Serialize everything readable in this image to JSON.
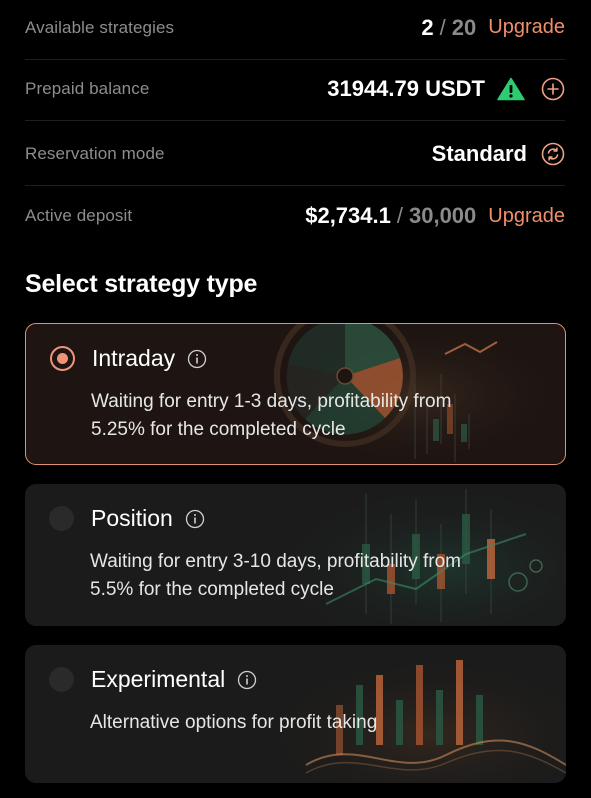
{
  "settings": {
    "strategies": {
      "label": "Available strategies",
      "used": "2",
      "separator": "/",
      "total": "20",
      "action": "Upgrade"
    },
    "balance": {
      "label": "Prepaid balance",
      "value": "31944.79 USDT",
      "status_icon": "warning-triangle-icon",
      "status_color": "#2ecc71",
      "action_icon": "plus-circle-icon"
    },
    "reservation": {
      "label": "Reservation mode",
      "value": "Standard",
      "action_icon": "swap-cycle-icon"
    },
    "deposit": {
      "label": "Active deposit",
      "current": "$2,734.1",
      "separator": "/",
      "limit": "30,000",
      "action": "Upgrade"
    }
  },
  "section": {
    "title": "Select strategy type"
  },
  "strategy_types": [
    {
      "title": "Intraday",
      "description": "Waiting for entry 1-3 days, profitability from 5.25% for the completed cycle",
      "selected": true
    },
    {
      "title": "Position",
      "description": "Waiting for entry 3-10 days, profitability from 5.5% for the completed cycle",
      "selected": false
    },
    {
      "title": "Experimental",
      "description": "Alternative options for profit taking",
      "selected": false
    }
  ],
  "colors": {
    "accent": "#ef9475",
    "background": "#000000",
    "card": "#1b1b1b",
    "muted_text": "#8d8d8d"
  }
}
